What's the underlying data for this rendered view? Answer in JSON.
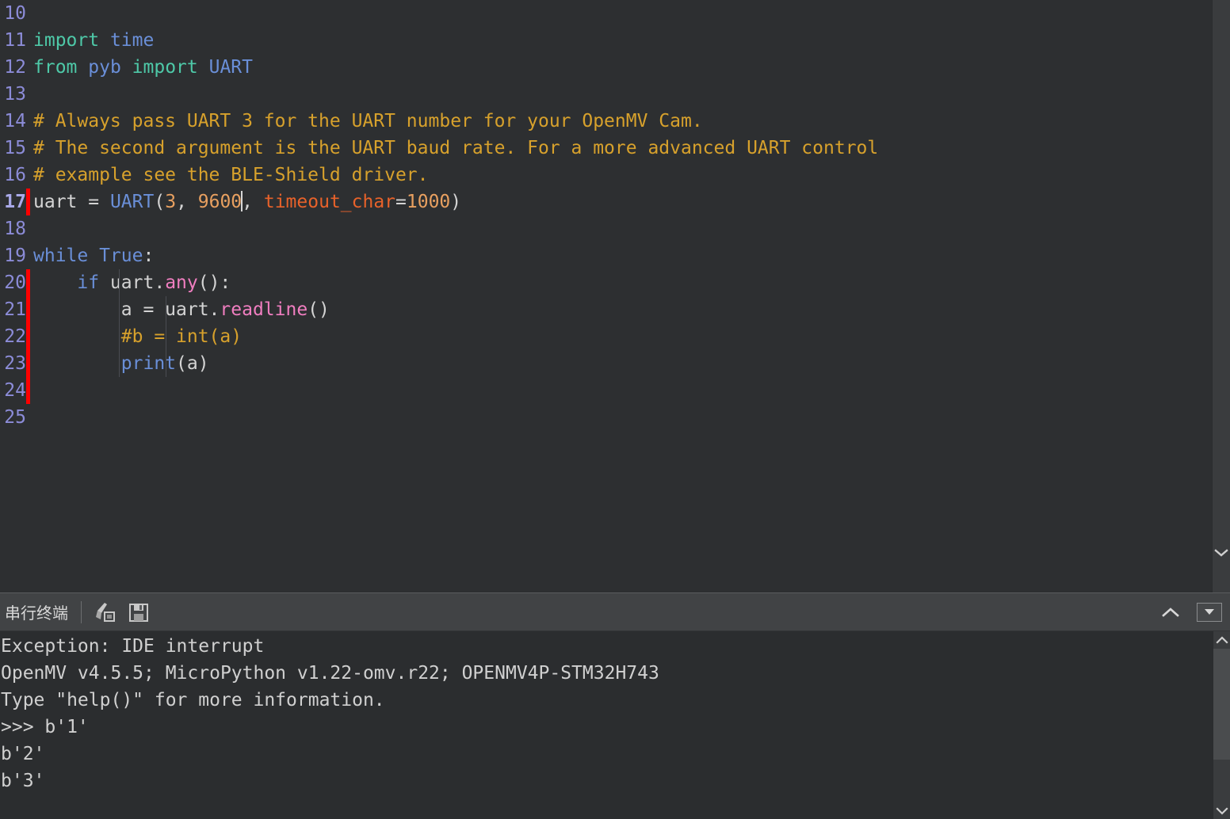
{
  "editor": {
    "language": "python",
    "first_visible_line": 10,
    "current_line": 17,
    "lines": [
      {
        "n": "10",
        "changed": false,
        "guides": 0,
        "tokens": []
      },
      {
        "n": "11",
        "changed": false,
        "guides": 0,
        "tokens": [
          {
            "t": "import",
            "c": "import"
          },
          {
            "t": " ",
            "c": "plain"
          },
          {
            "t": "time",
            "c": "kw"
          }
        ]
      },
      {
        "n": "12",
        "changed": false,
        "guides": 0,
        "tokens": [
          {
            "t": "from",
            "c": "import"
          },
          {
            "t": " ",
            "c": "plain"
          },
          {
            "t": "pyb",
            "c": "kw"
          },
          {
            "t": " ",
            "c": "plain"
          },
          {
            "t": "import",
            "c": "import"
          },
          {
            "t": " ",
            "c": "plain"
          },
          {
            "t": "UART",
            "c": "kw"
          }
        ]
      },
      {
        "n": "13",
        "changed": false,
        "guides": 0,
        "tokens": []
      },
      {
        "n": "14",
        "changed": false,
        "guides": 0,
        "tokens": [
          {
            "t": "# Always pass UART 3 for the UART number for your OpenMV Cam.",
            "c": "comment"
          }
        ]
      },
      {
        "n": "15",
        "changed": false,
        "guides": 0,
        "tokens": [
          {
            "t": "# The second argument is the UART baud rate. For a more advanced UART control",
            "c": "comment"
          }
        ]
      },
      {
        "n": "16",
        "changed": false,
        "guides": 0,
        "tokens": [
          {
            "t": "# example see the BLE-Shield driver.",
            "c": "comment"
          }
        ]
      },
      {
        "n": "17",
        "changed": true,
        "current": true,
        "guides": 0,
        "tokens": [
          {
            "t": "uart ",
            "c": "plain"
          },
          {
            "t": "= ",
            "c": "plain"
          },
          {
            "t": "UART",
            "c": "kw"
          },
          {
            "t": "(",
            "c": "plain"
          },
          {
            "t": "3",
            "c": "num"
          },
          {
            "t": ", ",
            "c": "plain"
          },
          {
            "t": "9600",
            "c": "num"
          },
          {
            "t": "",
            "c": "caret"
          },
          {
            "t": ", ",
            "c": "plain"
          },
          {
            "t": "timeout_char",
            "c": "param"
          },
          {
            "t": "=",
            "c": "plain"
          },
          {
            "t": "1000",
            "c": "num"
          },
          {
            "t": ")",
            "c": "plain"
          }
        ]
      },
      {
        "n": "18",
        "changed": false,
        "guides": 0,
        "tokens": []
      },
      {
        "n": "19",
        "changed": false,
        "guides": 0,
        "tokens": [
          {
            "t": "while",
            "c": "kw"
          },
          {
            "t": " ",
            "c": "plain"
          },
          {
            "t": "True",
            "c": "kw"
          },
          {
            "t": ":",
            "c": "plain"
          }
        ]
      },
      {
        "n": "20",
        "changed": true,
        "guides": 1,
        "tokens": [
          {
            "t": "    ",
            "c": "plain"
          },
          {
            "t": "if",
            "c": "kw"
          },
          {
            "t": " uart.",
            "c": "plain"
          },
          {
            "t": "any",
            "c": "meth"
          },
          {
            "t": "():",
            "c": "plain"
          }
        ]
      },
      {
        "n": "21",
        "changed": true,
        "guides": 2,
        "tokens": [
          {
            "t": "        a = uart.",
            "c": "plain"
          },
          {
            "t": "readline",
            "c": "meth"
          },
          {
            "t": "()",
            "c": "plain"
          }
        ]
      },
      {
        "n": "22",
        "changed": true,
        "guides": 2,
        "tokens": [
          {
            "t": "        ",
            "c": "plain"
          },
          {
            "t": "#b = int(a)",
            "c": "comment"
          }
        ]
      },
      {
        "n": "23",
        "changed": true,
        "guides": 2,
        "tokens": [
          {
            "t": "        ",
            "c": "plain"
          },
          {
            "t": "print",
            "c": "kw"
          },
          {
            "t": "(a)",
            "c": "plain"
          }
        ]
      },
      {
        "n": "24",
        "changed": true,
        "guides": 0,
        "tokens": []
      },
      {
        "n": "25",
        "changed": false,
        "guides": 0,
        "tokens": []
      }
    ],
    "collapse_icon": "chevron-down-icon"
  },
  "terminal": {
    "title": "串行终端",
    "buttons": [
      {
        "name": "clear-terminal-button",
        "icon": "broom-clear-icon",
        "label": ""
      },
      {
        "name": "save-terminal-button",
        "icon": "floppy-save-icon",
        "label": ""
      }
    ],
    "collapse_up_icon": "chevron-up-icon",
    "menu_icon": "chevron-down-icon",
    "output": [
      "Exception: IDE interrupt",
      "OpenMV v4.5.5; MicroPython v1.22-omv.r22; OPENMV4P-STM32H743",
      "Type \"help()\" for more information.",
      ">>> b'1'",
      "b'2'",
      "b'3'"
    ],
    "scrollbar": {
      "up_icon": "triangle-up-icon",
      "down_icon": "triangle-down-icon"
    }
  },
  "colors": {
    "editor_bg": "#2d2f31",
    "terminal_bg": "#2b2d2f",
    "header_bg": "#414345",
    "changebar": "#ff0000",
    "lineno": "#8c8cd8",
    "keyword": "#6a8fd8",
    "import": "#4ec9a8",
    "comment": "#d7a12c",
    "number": "#e8a060",
    "method": "#f07ec0",
    "param": "#e8622a",
    "plain": "#d4d4d4"
  }
}
